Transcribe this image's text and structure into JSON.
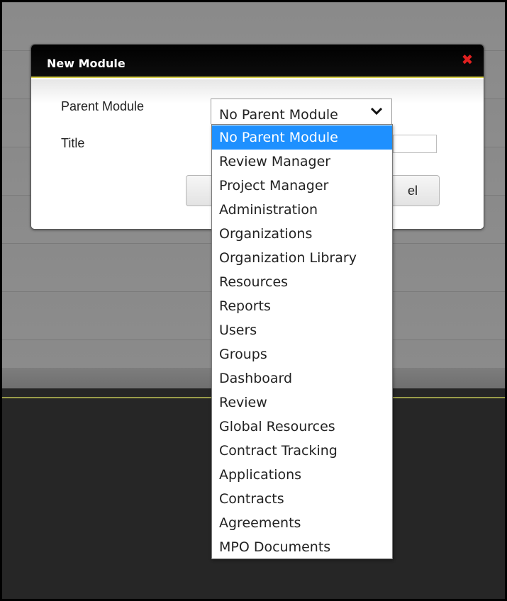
{
  "dialog": {
    "title": "New Module",
    "close_symbol": "✖",
    "labels": {
      "parent_module": "Parent Module",
      "title": "Title"
    },
    "title_input": {
      "value": "",
      "placeholder": ""
    },
    "buttons": {
      "save": "",
      "cancel": "el"
    }
  },
  "parent_select": {
    "selected": "No Parent Module",
    "options": [
      "No Parent Module",
      "Review Manager",
      "Project Manager",
      "Administration",
      "Organizations",
      "Organization Library",
      "Resources",
      "Reports",
      "Users",
      "Groups",
      "Dashboard",
      "Review",
      "Global Resources",
      "Contract Tracking",
      "Applications",
      "Contracts",
      "Agreements",
      "MPO Documents"
    ],
    "highlighted_index": 0
  },
  "colors": {
    "header_bg": "#000000",
    "header_accent": "#d8d04a",
    "close_icon": "#e02020",
    "highlight": "#1e90ff"
  },
  "icons": {
    "close": "close-icon",
    "dropdown": "chevron-down-icon"
  }
}
